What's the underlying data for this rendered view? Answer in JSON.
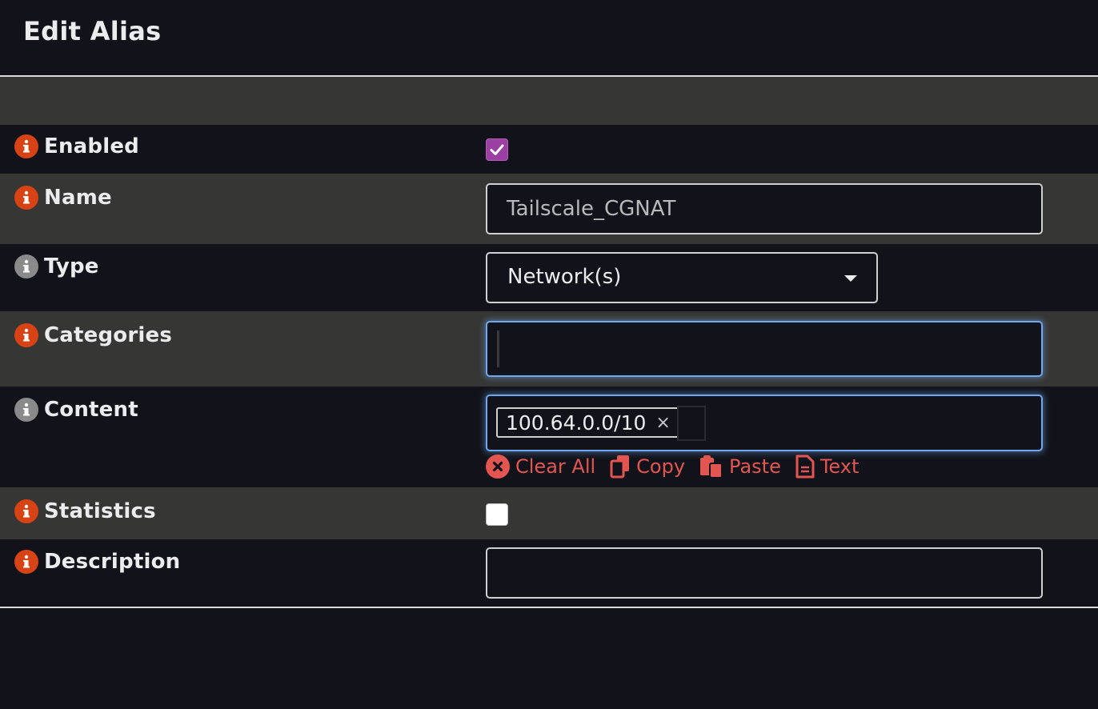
{
  "dialog": {
    "title": "Edit Alias"
  },
  "fields": {
    "enabled": {
      "label": "Enabled",
      "checked": true,
      "icon": "info-icon",
      "icon_color": "#d84315"
    },
    "name": {
      "label": "Name",
      "value": "Tailscale_CGNAT",
      "icon": "info-icon",
      "icon_color": "#d84315"
    },
    "type": {
      "label": "Type",
      "value": "Network(s)",
      "icon": "info-icon",
      "icon_color": "#8a8a8a"
    },
    "categories": {
      "label": "Categories",
      "value": "",
      "icon": "info-icon",
      "icon_color": "#d84315"
    },
    "content": {
      "label": "Content",
      "icon": "info-icon",
      "icon_color": "#8a8a8a",
      "tags": [
        "100.64.0.0/10"
      ],
      "tag_remove": "×",
      "tools": {
        "clear_all": "Clear All",
        "copy": "Copy",
        "paste": "Paste",
        "text": "Text"
      }
    },
    "statistics": {
      "label": "Statistics",
      "checked": false,
      "icon": "info-icon",
      "icon_color": "#d84315"
    },
    "description": {
      "label": "Description",
      "value": "",
      "icon": "info-icon",
      "icon_color": "#d84315"
    }
  },
  "colors": {
    "background": "#12131a",
    "row_alt": "#363634",
    "accent_checkbox": "#9b3fa3",
    "focus": "#6ea8ee",
    "tool_link": "#e25550"
  }
}
